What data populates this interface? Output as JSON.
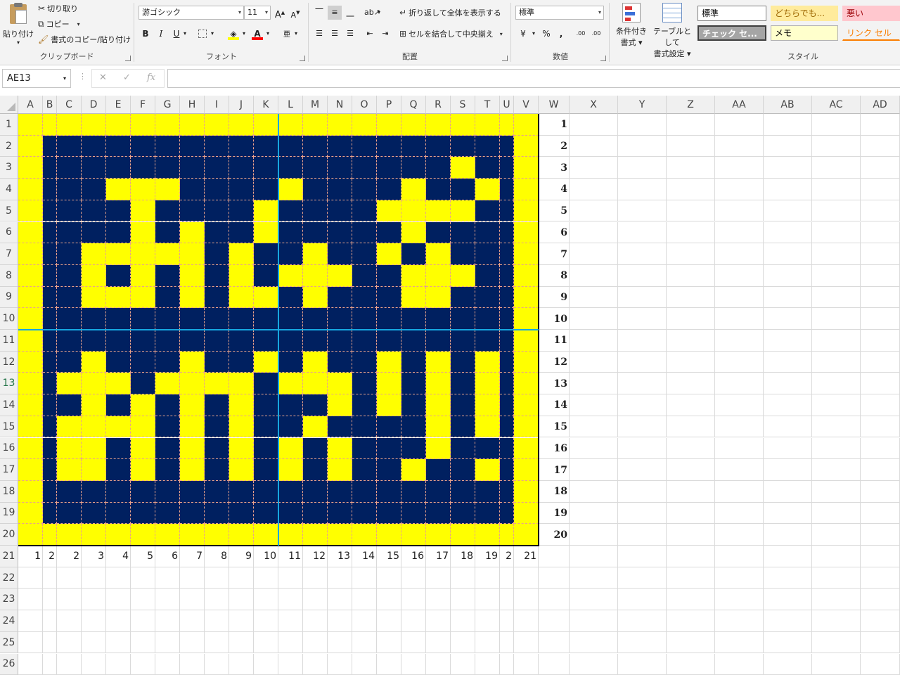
{
  "ribbon": {
    "clipboard": {
      "paste": "貼り付け",
      "cut": "切り取り",
      "copy": "コピー",
      "format_painter": "書式のコピー/貼り付け",
      "group_label": "クリップボード"
    },
    "font": {
      "font_name": "游ゴシック",
      "font_size": "11",
      "grow_icon": "A",
      "shrink_icon": "A",
      "bold": "B",
      "italic": "I",
      "underline": "U",
      "font_color_glyph": "A",
      "phonetic_glyph": "亜",
      "group_label": "フォント"
    },
    "alignment": {
      "wrap_text": "折り返して全体を表示する",
      "merge_center": "セルを結合して中央揃え",
      "group_label": "配置"
    },
    "number": {
      "format": "標準",
      "percent": "%",
      "comma": ",",
      "inc_decimal": ".00",
      "dec_decimal": ".00",
      "group_label": "数値"
    },
    "styles": {
      "conditional_line1": "条件付き",
      "conditional_line2": "書式",
      "table_line1": "テーブルとして",
      "table_line2": "書式設定",
      "cells": [
        {
          "label": "標準",
          "bg": "#ffffff",
          "fg": "#000000",
          "border": "#7f7f7f"
        },
        {
          "label": "どちらでも...",
          "bg": "#ffeb9c",
          "fg": "#9c6500",
          "border": "#ffeb9c"
        },
        {
          "label": "悪い",
          "bg": "#ffc7ce",
          "fg": "#9c0006",
          "border": "#ffc7ce"
        },
        {
          "label": "チェック セ...",
          "bg": "#a5a5a5",
          "fg": "#ffffff",
          "border": "#3f3f3f"
        },
        {
          "label": "メモ",
          "bg": "#ffffcc",
          "fg": "#000000",
          "border": "#b2b2b2"
        },
        {
          "label": "リンク セル",
          "bg": "#f3f3f3",
          "fg": "#fa7d00",
          "border": "#f3f3f3"
        }
      ],
      "group_label": "スタイル"
    }
  },
  "formula_bar": {
    "name_box": "AE13",
    "cancel_icon": "✕",
    "enter_icon": "✓",
    "fx_icon": "fx",
    "formula": ""
  },
  "sheet": {
    "columns": [
      "A",
      "B",
      "C",
      "D",
      "E",
      "F",
      "G",
      "H",
      "I",
      "J",
      "K",
      "L",
      "M",
      "N",
      "O",
      "P",
      "Q",
      "R",
      "S",
      "T",
      "U",
      "V",
      "W",
      "X",
      "Y",
      "Z",
      "AA",
      "AB",
      "AC",
      "AD"
    ],
    "rows": [
      "1",
      "2",
      "3",
      "4",
      "5",
      "6",
      "7",
      "8",
      "9",
      "10",
      "11",
      "12",
      "13",
      "14",
      "15",
      "16",
      "17",
      "18",
      "19",
      "20",
      "21",
      "22",
      "23",
      "24",
      "25",
      "26"
    ],
    "active_row": "13",
    "colors": {
      "yellow": "#ffff00",
      "navy": "#002060",
      "split_line": "#16a7e0"
    },
    "pattern": [
      "YYYYYYYYYYYYYYYYYYYYYY",
      "YNNNNNNNNNNNNNNNNNNNNY",
      "YNNNNNNNNNNNNNNNNNYNNY",
      "YNNNYYYNNNNYNNNNYNNYNY",
      "YNNNNYNNNNYNNNNYYYYNNY",
      "YNNNNYNYNNYNNNNNYNNNNY",
      "YNNYYYYYNYNNYNNYNYNNNY",
      "YNNYNYNYNYNYYYNNYYYNNY",
      "YNNYYYNYNYYNYNNNYYNNNY",
      "YNNNNNNNNNNNNNNNNNNNNY",
      "YNNNNNNNNNNNNNNNNNNNNY",
      "YNNYNNNYNNYNYNNYNYNYNY",
      "YNYYYNYYYYNYYYNYNYNYNY",
      "YNNYNYNYNYNNNYNYNYNYNY",
      "YNYYYYNYNYNNYNNNNYNYNY",
      "YNYYNYNYNYNYNYNNNYNNNY",
      "YNYYNYNYNYNYNYNNYNNYNY",
      "YNNNNNNNNNNNNNNNNNNNNY",
      "YNNNNNNNNNNNNNNNNNNNNY",
      "YYYYYYYYYYYYYYYYYYYYYY"
    ],
    "row21_values": [
      "1",
      "2",
      "2",
      "3",
      "4",
      "5",
      "6",
      "7",
      "8",
      "9",
      "10",
      "11",
      "12",
      "13",
      "14",
      "15",
      "16",
      "17",
      "18",
      "19",
      "2",
      "21"
    ],
    "w_column_values": [
      "1",
      "2",
      "3",
      "4",
      "5",
      "6",
      "7",
      "8",
      "9",
      "10",
      "11",
      "12",
      "13",
      "14",
      "15",
      "16",
      "17",
      "18",
      "19",
      "20"
    ]
  }
}
